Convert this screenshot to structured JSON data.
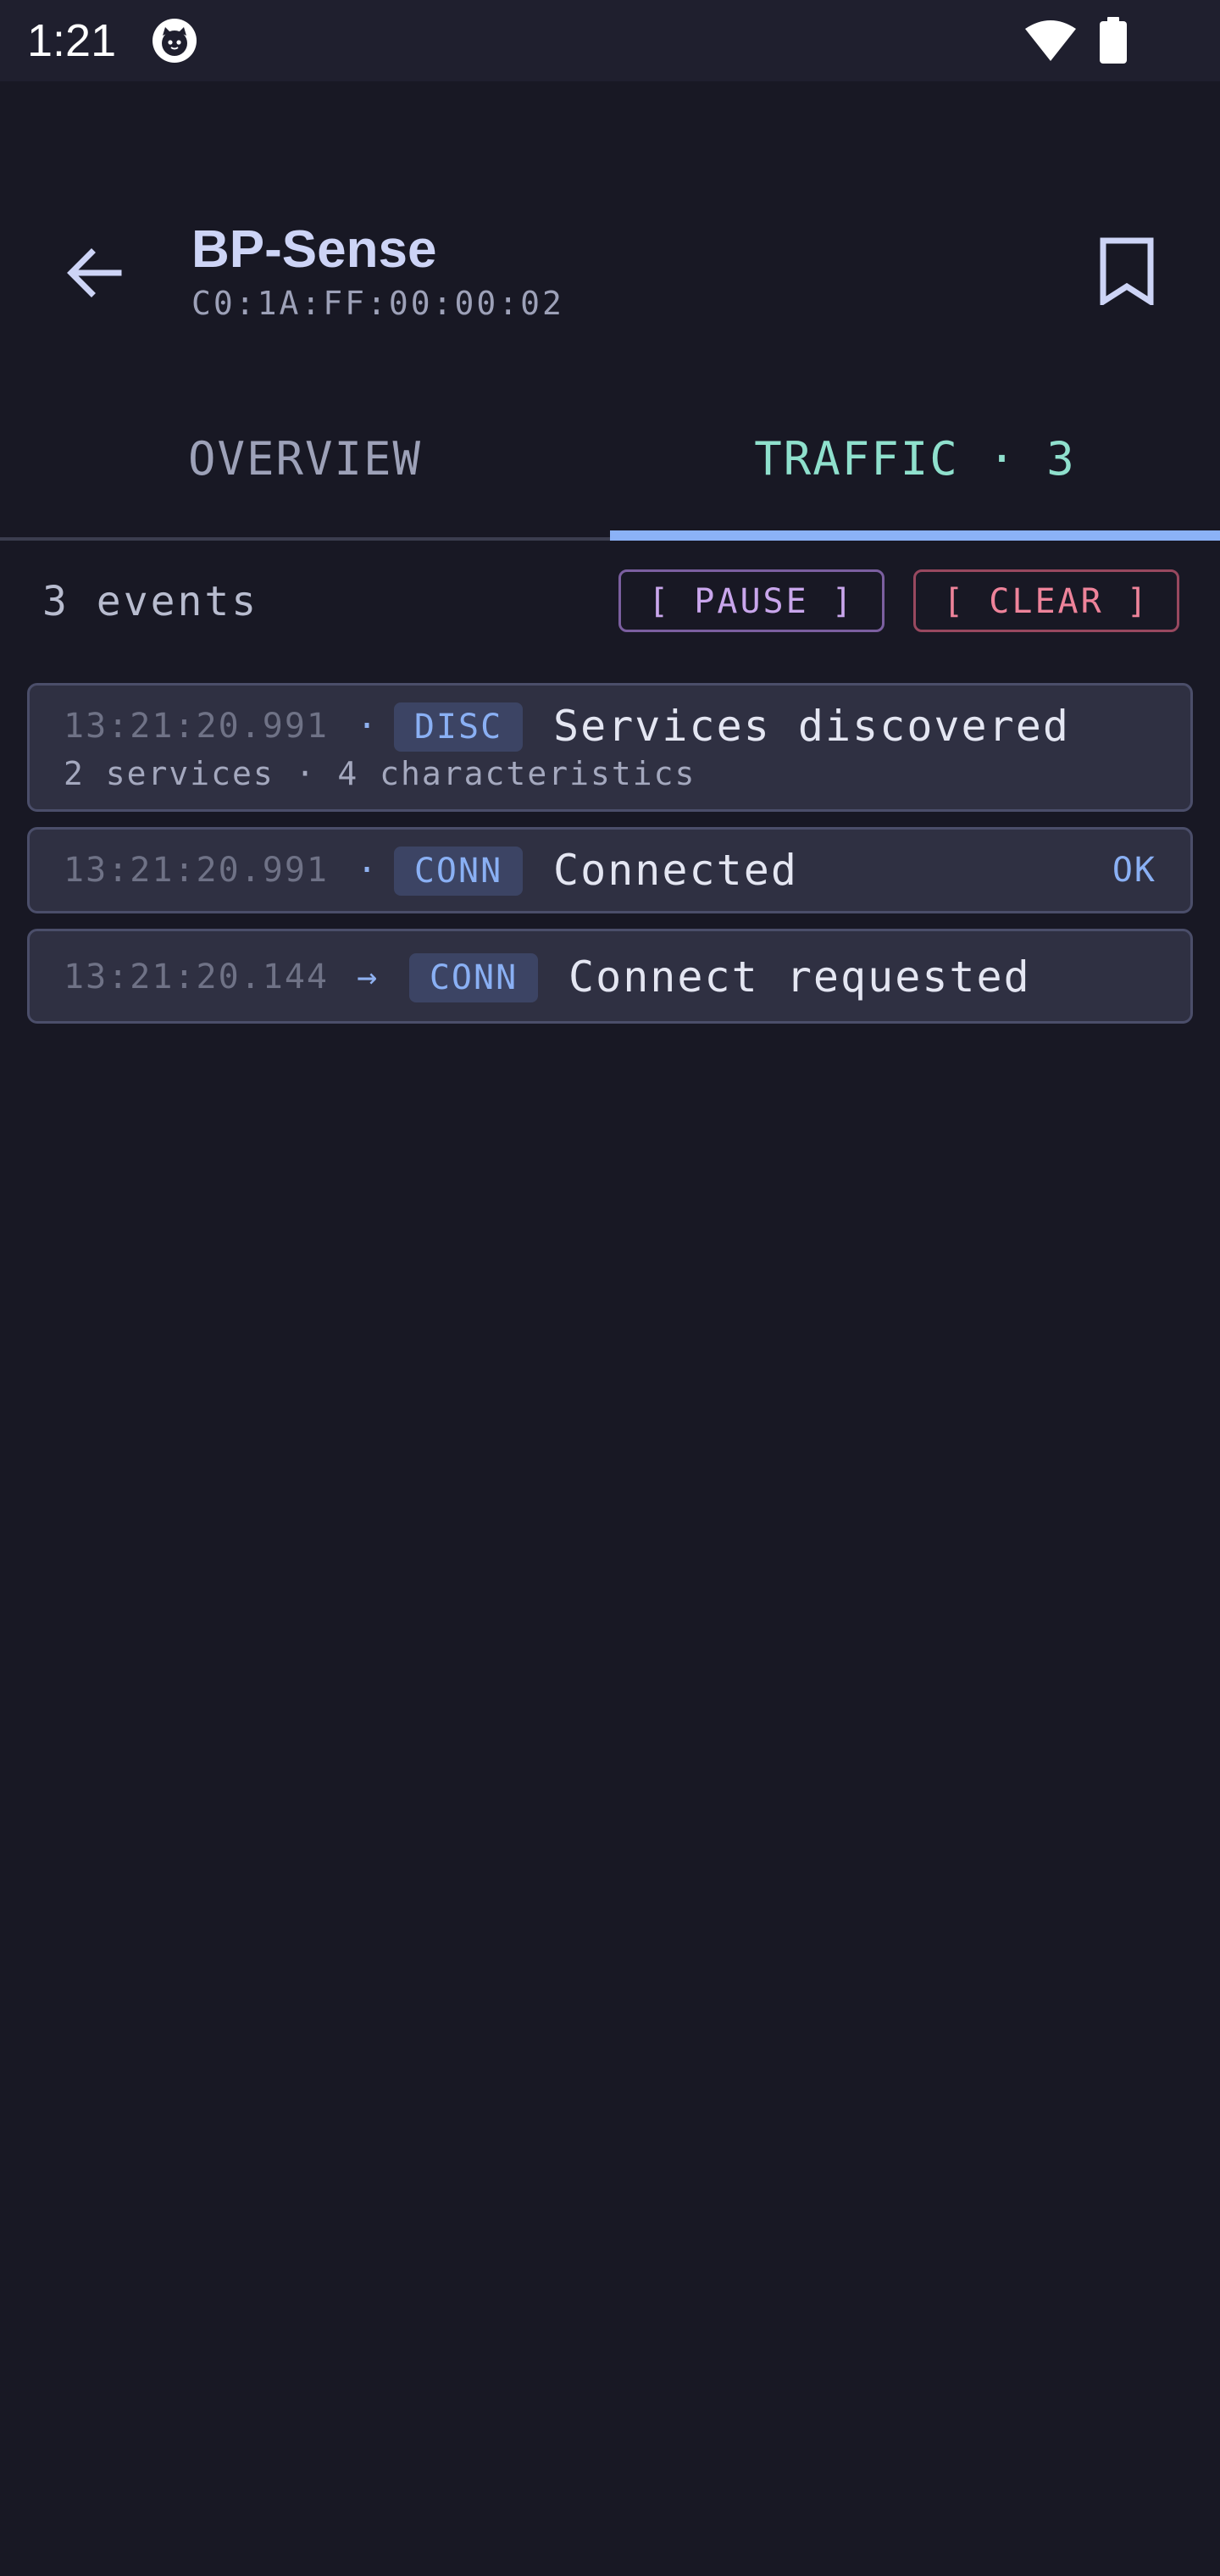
{
  "status_bar": {
    "time": "1:21"
  },
  "app_bar": {
    "device_name": "BP-Sense",
    "device_address": "C0:1A:FF:00:00:02"
  },
  "tabs": [
    {
      "label": "OVERVIEW",
      "selected": false
    },
    {
      "label": "TRAFFIC · 3",
      "selected": true
    }
  ],
  "toolbar": {
    "event_count": "3 events",
    "pause_label": "[ PAUSE ]",
    "clear_label": "[ CLEAR ]"
  },
  "events": [
    {
      "time": "13:21:20.991",
      "direction": "·",
      "tag": "DISC",
      "title": "Services discovered",
      "detail": "2 services · 4 characteristics",
      "status": ""
    },
    {
      "time": "13:21:20.991",
      "direction": "·",
      "tag": "CONN",
      "title": "Connected",
      "detail": "",
      "status": "OK"
    },
    {
      "time": "13:21:20.144",
      "direction": "→",
      "tag": "CONN",
      "title": "Connect requested",
      "detail": "",
      "status": ""
    }
  ],
  "colors": {
    "background": "#181824",
    "accent_tab": "#8fe0cd",
    "tab_indicator": "#8bb2f7",
    "pause_border": "#7b5fa0",
    "clear_border": "#98485f",
    "card_background": "#2f3042"
  }
}
